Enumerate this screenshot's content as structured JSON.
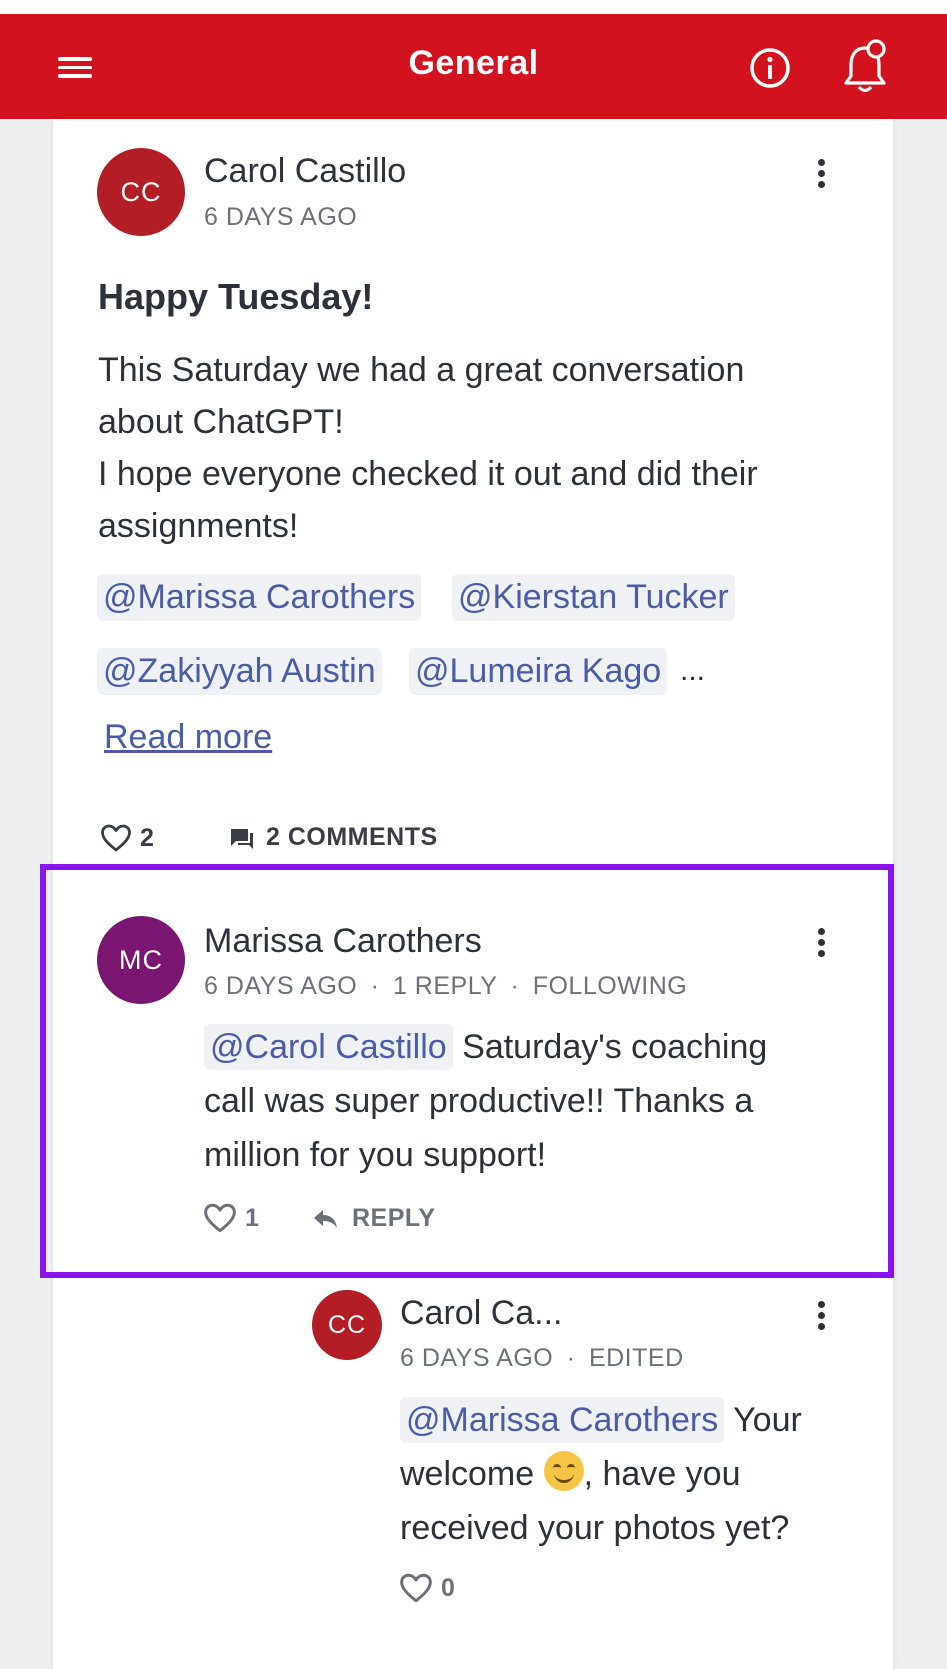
{
  "header": {
    "title": "General",
    "menu_icon": "hamburger-menu-icon",
    "info_icon": "info-icon",
    "notification_icon": "bell-icon"
  },
  "colors": {
    "header_bg": "#d2121e",
    "highlight_border": "#8a13ef",
    "mention_text": "#4a5ca8",
    "avatar_carol": "#b31e26",
    "avatar_marissa": "#7a1571"
  },
  "post": {
    "author": "Carol Castillo",
    "avatar_initials": "CC",
    "time": "6 DAYS AGO",
    "title": "Happy Tuesday!",
    "body_lines": [
      "This Saturday we had a great conversation",
      "about ChatGPT!",
      "I hope everyone checked it out and did their",
      "assignments!"
    ],
    "mentions": [
      "@Marissa Carothers",
      "@Kierstan Tucker",
      "@Zakiyyah Austin",
      "@Lumeira Kago"
    ],
    "ellipsis": "...",
    "read_more": "Read more",
    "likes": "2",
    "comments": "2 COMMENTS"
  },
  "comment": {
    "author": "Marissa Carothers",
    "avatar_initials": "MC",
    "time": "6 DAYS AGO",
    "replies": "1 REPLY",
    "following": "FOLLOWING",
    "separator": "·",
    "mention": "@Carol Castillo",
    "body_line1_rest": " Saturday's coaching",
    "body_line2": "call was super productive!!  Thanks a",
    "body_line3": "million for you support!",
    "likes": "1",
    "reply_label": "REPLY"
  },
  "reply": {
    "author": "Carol Ca...",
    "avatar_initials": "CC",
    "time": "6 DAYS AGO",
    "edited": "EDITED",
    "separator": "·",
    "mention": "@Marissa Carothers",
    "body_line1_rest": " Your",
    "body_line2_before": "welcome ",
    "emoji": "smiling-face-emoji",
    "body_line2_after": ", have you",
    "body_line3": "received your photos yet?",
    "likes": "0"
  }
}
